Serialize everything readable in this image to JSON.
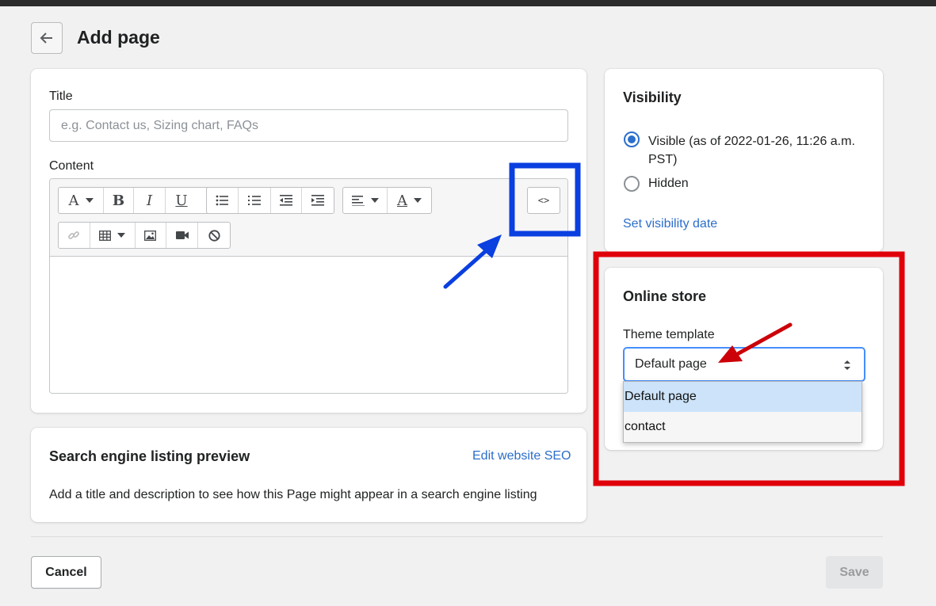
{
  "header": {
    "title": "Add page"
  },
  "main": {
    "title_label": "Title",
    "title_placeholder": "e.g. Contact us, Sizing chart, FAQs",
    "content_label": "Content",
    "toolbar": {
      "font_glyph": "A",
      "bold_glyph": "B",
      "italic_glyph": "I",
      "underline_glyph": "U",
      "color_glyph": "A",
      "code_glyph": "<>"
    }
  },
  "seo": {
    "title": "Search engine listing preview",
    "edit_link": "Edit website SEO",
    "description": "Add a title and description to see how this Page might appear in a search engine listing"
  },
  "visibility": {
    "title": "Visibility",
    "visible_label": "Visible (as of 2022-01-26, 11:26 a.m. PST)",
    "hidden_label": "Hidden",
    "selected": "visible",
    "set_date_link": "Set visibility date"
  },
  "online_store": {
    "title": "Online store",
    "template_label": "Theme template",
    "selected_value": "Default page",
    "options": [
      "Default page",
      "contact"
    ]
  },
  "footer": {
    "cancel_label": "Cancel",
    "save_label": "Save"
  },
  "colors": {
    "accent": "#2c6ecb",
    "annotation_blue": "#0a3fe0",
    "annotation_red": "#e0000a"
  }
}
